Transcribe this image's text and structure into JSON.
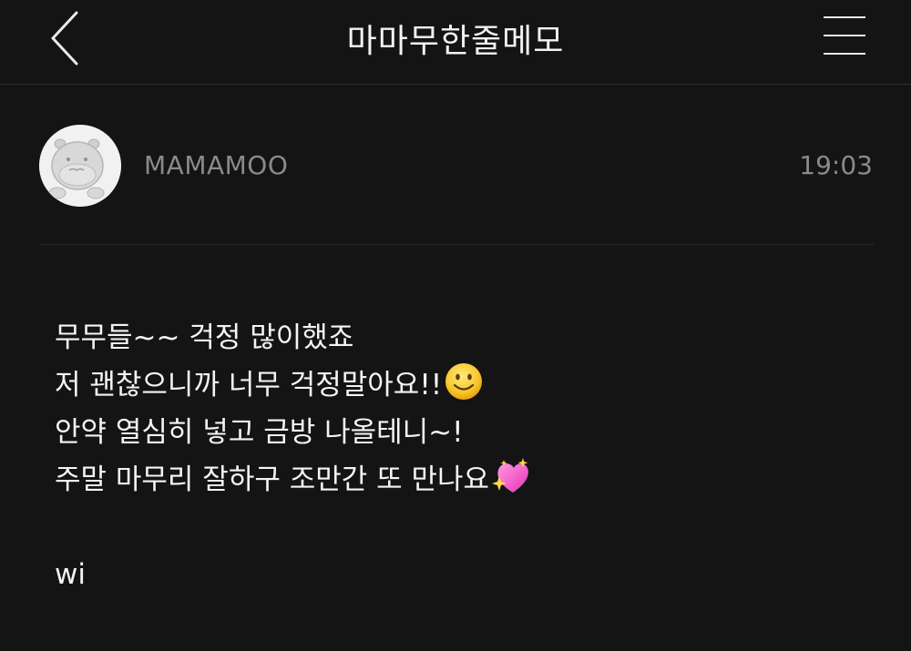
{
  "header": {
    "title": "마마무한줄메모",
    "back_icon": "chevron-left-icon",
    "menu_icon": "hamburger-menu-icon"
  },
  "post": {
    "author": "MAMAMOO",
    "time": "19:03",
    "avatar_icon": "hippo-avatar-icon"
  },
  "memo": {
    "lines": [
      "무무들~~ 걱정 많이했죠",
      "저 괜찮으니까 너무 걱정말아요!!",
      "안약 열심히 넣고 금방 나올테니~!",
      "주말 마무리 잘하구 조만간 또 만나요"
    ],
    "line2_emoji": "slightly-smiling-face-icon",
    "line4_emoji": "sparkling-heart-icon",
    "signature": "wi"
  },
  "colors": {
    "background": "#141414",
    "text": "#f4f4f4",
    "muted": "#8a8a8a",
    "divider": "#2a2a2a"
  }
}
